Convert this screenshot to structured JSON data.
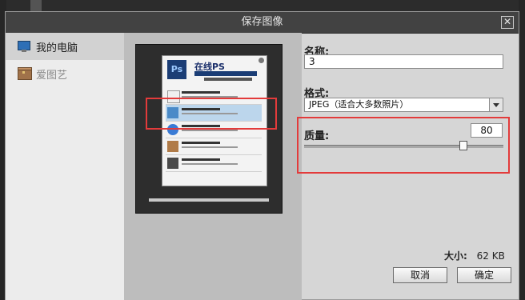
{
  "dialog": {
    "title": "保存图像"
  },
  "sidebar": {
    "items": [
      {
        "label": "我的电脑",
        "icon": "computer-icon",
        "active": true
      },
      {
        "label": "爱图艺",
        "icon": "chest-icon",
        "active": false
      }
    ]
  },
  "form": {
    "name_label": "名称:",
    "name_value": "3",
    "format_label": "格式:",
    "format_value": "JPEG（适合大多数照片）",
    "quality_label": "质量:",
    "quality_value": "80",
    "size_label": "大小:",
    "size_value": "62 KB"
  },
  "preview_image": {
    "brand": "在线PS"
  },
  "buttons": {
    "cancel": "取消",
    "ok": "确定"
  },
  "colors": {
    "highlight_box": "#e33b3b",
    "titlebar": "#424242"
  }
}
